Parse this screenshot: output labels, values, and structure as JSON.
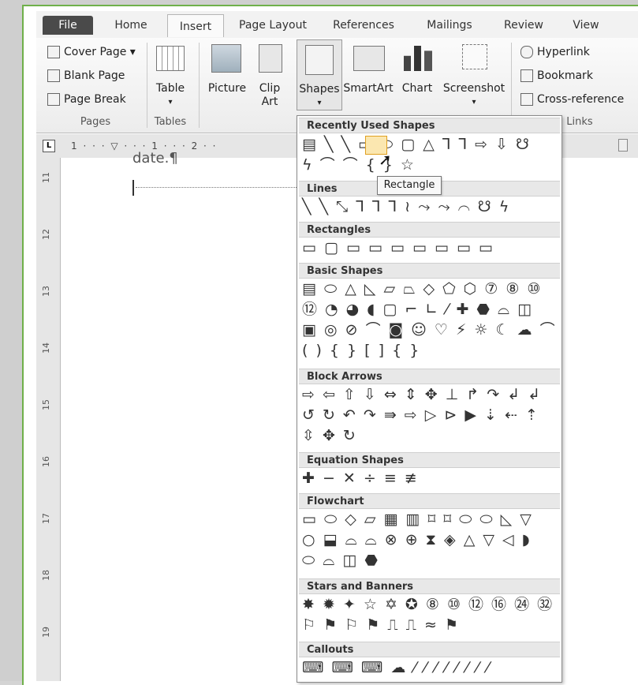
{
  "tabs": [
    "File",
    "Home",
    "Insert",
    "Page Layout",
    "References",
    "Mailings",
    "Review",
    "View"
  ],
  "active_tab": "Insert",
  "pages_group": {
    "label": "Pages",
    "items": [
      "Cover Page ▾",
      "Blank Page",
      "Page Break"
    ]
  },
  "tables_group": {
    "label": "Tables",
    "table": "Table"
  },
  "illustrations": {
    "picture": "Picture",
    "clip_art_1": "Clip",
    "clip_art_2": "Art",
    "shapes": "Shapes",
    "smartart": "SmartArt",
    "chart": "Chart",
    "screenshot": "Screenshot"
  },
  "links_group": {
    "label": "Links",
    "items": [
      "Hyperlink",
      "Bookmark",
      "Cross-reference"
    ]
  },
  "ruler": {
    "corner": "L",
    "ticks": "1 · · · ▽ · · · 1 · · · 2 · ·"
  },
  "vertical_ruler": [
    "11",
    "12",
    "13",
    "14",
    "15",
    "16",
    "17",
    "18",
    "19"
  ],
  "document": {
    "text": "date.¶"
  },
  "tooltip": "Rectangle",
  "sections": [
    {
      "title": "Recently Used Shapes",
      "rows": [
        "▤ ╲ ╲ ▭ ⬭ ▢ △ ⅂ ⅂ ⇨ ⇩ ☋",
        "ϟ ⌒ ⌒ { } ☆"
      ]
    },
    {
      "title": "Lines",
      "rows": [
        "╲ ╲ ⤡ ⅂ ⅂ ⅂ ≀ ⤳ ⤳ ⌒ ☋ ϟ"
      ]
    },
    {
      "title": "Rectangles",
      "rows": [
        "▭ ▢ ▭ ▭ ▭ ▭ ▭ ▭ ▭"
      ]
    },
    {
      "title": "Basic Shapes",
      "rows": [
        "▤ ⬭ △ ◺ ▱ ⏢ ◇ ⬠ ⬡ ⑦ ⑧ ⑩",
        "⑫ ◔ ◕ ◖ ▢ ⌐ ∟ ⁄ ✚ ⬣ ⌓ ◫",
        "▣ ◎ ⊘ ⌒ ◙ ☺ ♡ ⚡ ☼ ☾ ☁ ⌒",
        "( ) { } [ ] { }"
      ]
    },
    {
      "title": "Block Arrows",
      "rows": [
        "⇨ ⇦ ⇧ ⇩ ⇔ ⇕ ✥ ⊥ ↱ ↷ ↲ ↲",
        "↺ ↻ ↶ ↷ ⇛ ⇨ ▷ ⊳ ▶ ⇣ ⇠ ⇡",
        "⇳ ✥ ↻"
      ]
    },
    {
      "title": "Equation Shapes",
      "rows": [
        "✚ − ✕ ÷ ≡ ≢"
      ]
    },
    {
      "title": "Flowchart",
      "rows": [
        "▭ ⬭ ◇ ▱ ▦ ▥ ⌑ ⌑ ⬭ ⬭ ◺ ▽",
        "○ ⬓ ⌓ ⌓ ⊗ ⊕ ⧗ ◈ △ ▽ ◁ ◗",
        "⬭ ⌓ ◫ ⬣"
      ]
    },
    {
      "title": "Stars and Banners",
      "rows": [
        "✸ ✹ ✦ ☆ ✡ ✪ ⑧ ⑩ ⑫ ⑯ ㉔ ㉜",
        "⚐ ⚑ ⚐ ⚑ ⎍ ⎍ ≈ ⚑"
      ]
    },
    {
      "title": "Callouts",
      "rows": [
        "⌨ ⌨ ⌨ ☁ ⁄ ⁄ ⁄ ⁄ ⁄ ⁄ ⁄ ⁄"
      ]
    }
  ]
}
